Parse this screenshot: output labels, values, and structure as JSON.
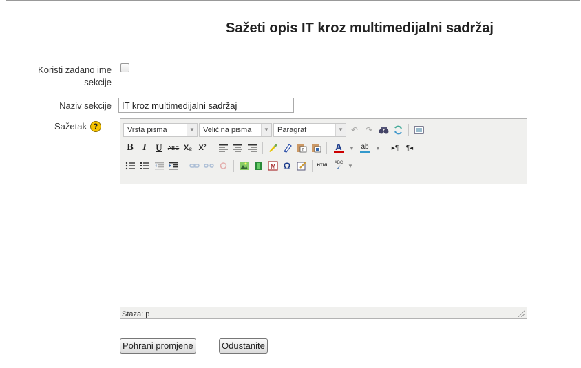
{
  "page": {
    "title": "Sažeti opis IT kroz multimedijalni sadržaj"
  },
  "form": {
    "use_default_label": "Koristi zadano ime sekcije",
    "use_default_line1": "Koristi zadano ime",
    "use_default_line2": "sekcije",
    "use_default_checked": false,
    "name_label": "Naziv sekcije",
    "name_value": "IT kroz multimedijalni sadržaj",
    "summary_label": "Sažetak",
    "help_icon": "?"
  },
  "editor": {
    "font_family_label": "Vrsta pisma",
    "font_size_label": "Veličina pisma",
    "format_label": "Paragraf",
    "icons": {
      "row1": [
        "undo-icon",
        "redo-icon",
        "find-icon",
        "replace-icon",
        "fullscreen-icon"
      ],
      "row2": [
        "bold-icon",
        "italic-icon",
        "underline-icon",
        "strikethrough-icon",
        "subscript-icon",
        "superscript-icon",
        "align-left-icon",
        "align-center-icon",
        "align-right-icon",
        "cleanup-icon",
        "remove-format-icon",
        "paste-text-icon",
        "paste-word-icon",
        "text-color-icon",
        "highlight-color-icon",
        "ltr-icon",
        "rtl-icon"
      ],
      "row3": [
        "bullet-list-icon",
        "numbered-list-icon",
        "outdent-icon",
        "indent-icon",
        "link-icon",
        "unlink-icon",
        "anchor-icon",
        "image-icon",
        "media-icon",
        "moodle-media-icon",
        "special-char-icon",
        "emoticon-icon",
        "html-source-icon",
        "spellcheck-icon"
      ]
    },
    "bold_glyph": "B",
    "italic_glyph": "I",
    "underline_glyph": "U",
    "strike_glyph": "ABC",
    "sub_glyph": "X₂",
    "sup_glyph": "X²",
    "text_color_glyph": "A",
    "highlight_glyph": "ab",
    "special_char_glyph": "Ω",
    "html_glyph": "HTML",
    "spell_glyph": "ABC",
    "status_path": "Staza: p",
    "colors": {
      "text_color_bar": "#cc0000",
      "highlight_bar": "#3399cc"
    }
  },
  "buttons": {
    "save": "Pohrani promjene",
    "cancel": "Odustanite"
  }
}
